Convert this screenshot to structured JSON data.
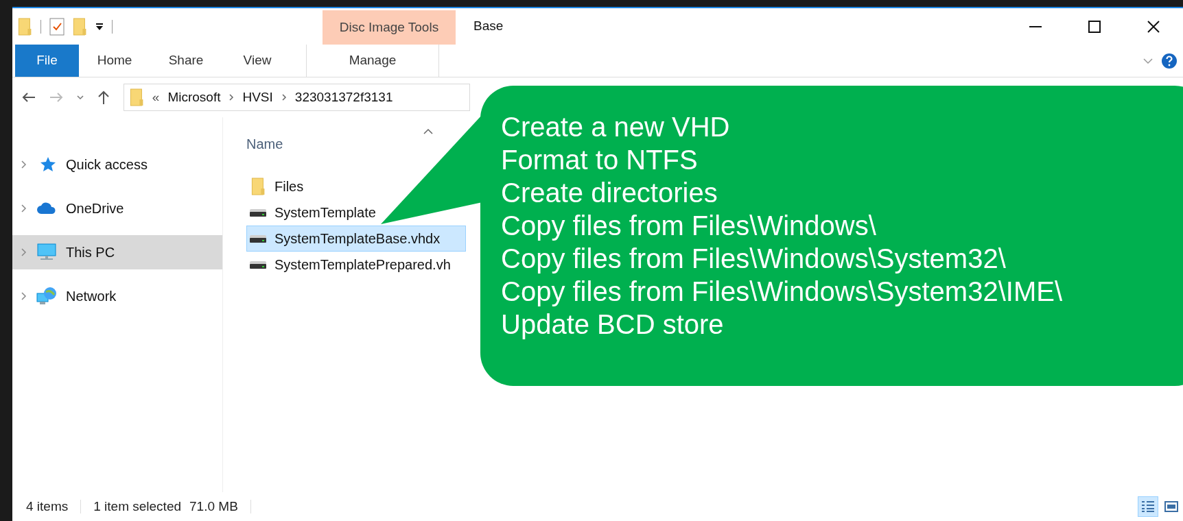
{
  "window": {
    "title": "Base"
  },
  "contextual_tab_group": {
    "label": "Disc Image Tools"
  },
  "ribbon_tabs": [
    {
      "label": "File",
      "kind": "file",
      "selected": false
    },
    {
      "label": "Home",
      "kind": "tab",
      "selected": false
    },
    {
      "label": "Share",
      "kind": "tab",
      "selected": false
    },
    {
      "label": "View",
      "kind": "tab",
      "selected": false
    },
    {
      "label": "Manage",
      "kind": "contextual",
      "selected": false
    }
  ],
  "address_bar": {
    "overflow": "«",
    "segments": [
      "Microsoft",
      "HVSI",
      "323031372f3131"
    ]
  },
  "navigation_pane": {
    "items": [
      {
        "label": "Quick access",
        "selected": false
      },
      {
        "label": "OneDrive",
        "selected": false
      },
      {
        "label": "This PC",
        "selected": true
      },
      {
        "label": "Network",
        "selected": false
      }
    ]
  },
  "file_list": {
    "columns": [
      "Name"
    ],
    "rows": [
      {
        "name": "Files",
        "kind": "folder",
        "selected": false
      },
      {
        "name": "SystemTemplate",
        "kind": "disk",
        "selected": false
      },
      {
        "name": "SystemTemplateBase.vhdx",
        "kind": "disk",
        "selected": true
      },
      {
        "name": "SystemTemplatePrepared.vh",
        "kind": "disk",
        "selected": false
      }
    ]
  },
  "callout": {
    "lines": [
      "Create a new VHD",
      "Format to NTFS",
      "Create directories",
      "Copy files from Files\\Windows\\",
      "Copy files from Files\\Windows\\System32\\",
      "Copy files from Files\\Windows\\System32\\IME\\",
      "Update BCD store"
    ]
  },
  "status_bar": {
    "item_count": "4 items",
    "selection": "1 item selected",
    "size": "71.0 MB"
  },
  "view_buttons": [
    {
      "selected": true
    },
    {
      "selected": false
    }
  ]
}
